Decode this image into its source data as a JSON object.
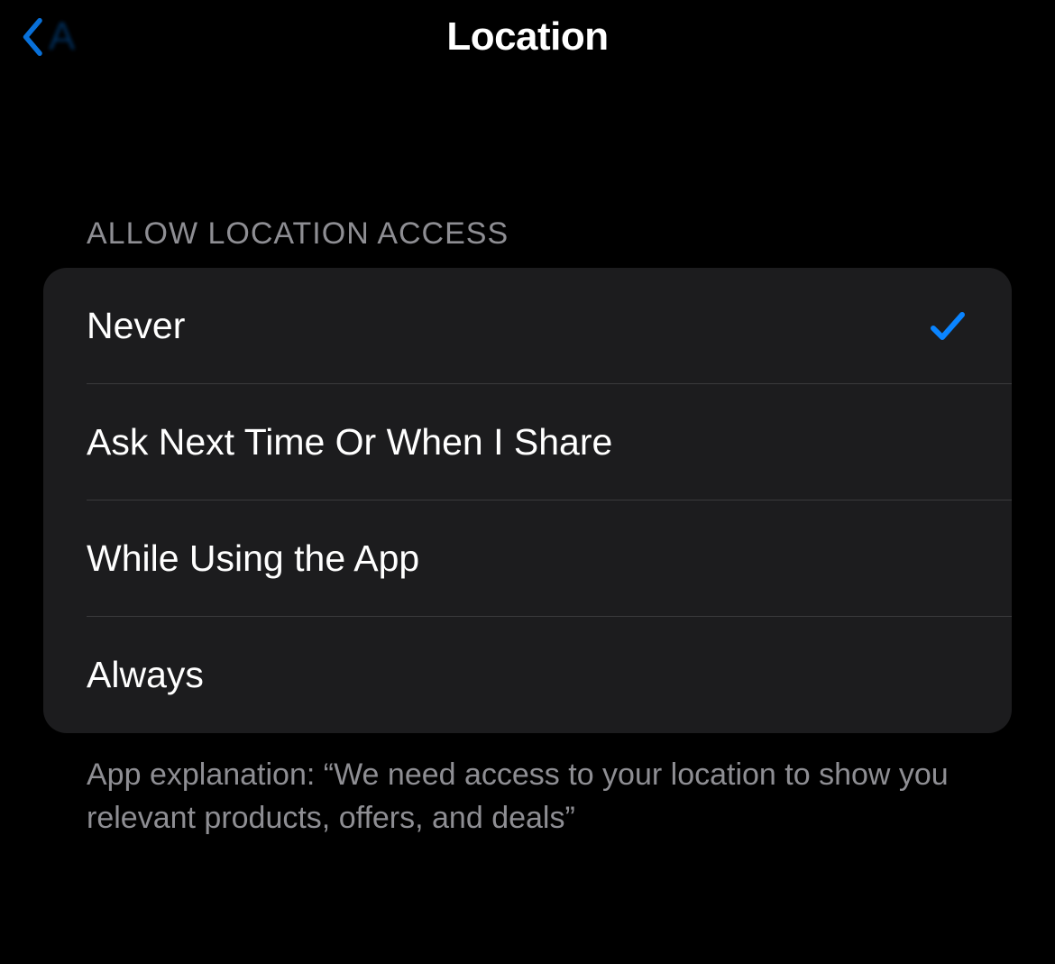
{
  "header": {
    "back_label": "A",
    "title": "Location"
  },
  "section_header": "ALLOW LOCATION ACCESS",
  "options": [
    {
      "label": "Never",
      "selected": true
    },
    {
      "label": "Ask Next Time Or When I Share",
      "selected": false
    },
    {
      "label": "While Using the App",
      "selected": false
    },
    {
      "label": "Always",
      "selected": false
    }
  ],
  "footer_text": "App explanation: “We need access to your location to show you relevant products, offers, and deals”",
  "colors": {
    "accent": "#0a84ff",
    "bg": "#000000",
    "cell_bg": "#1c1c1e",
    "secondary_text": "#8e8e93"
  }
}
